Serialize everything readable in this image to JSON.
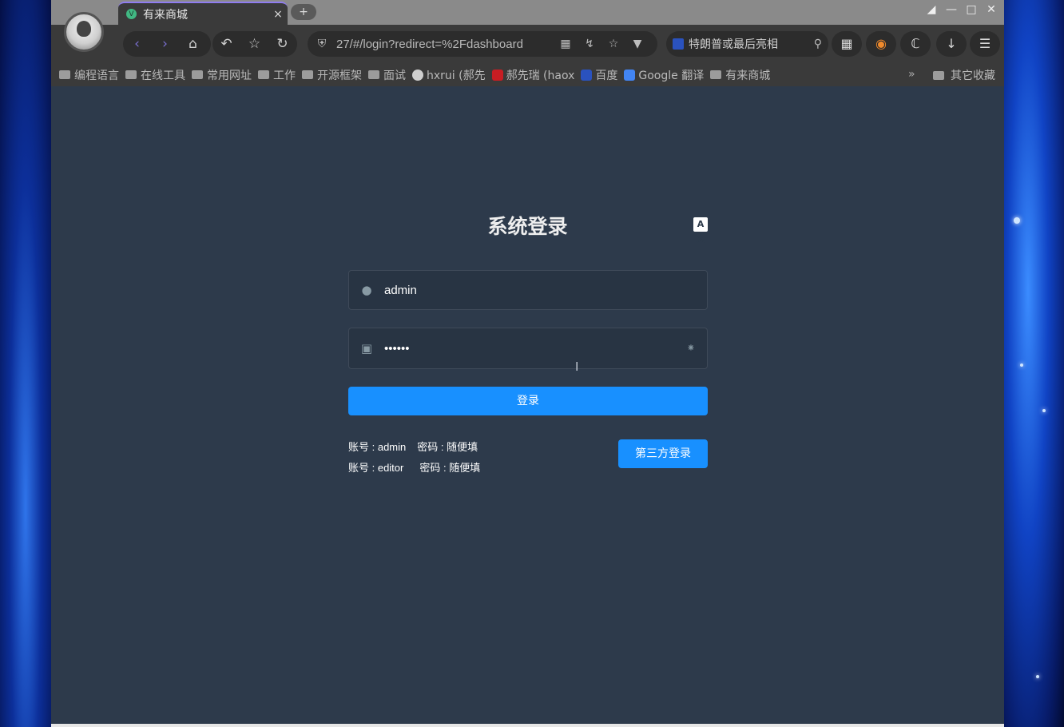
{
  "browser": {
    "tab_title": "有来商城",
    "tab_close": "×",
    "new_tab": "+",
    "url": "27/#/login?redirect=%2Fdashboard",
    "search_text": "特朗普或最后亮相",
    "window_controls": [
      "shirt-icon",
      "minimize-icon",
      "maximize-icon",
      "close-icon"
    ]
  },
  "bookmarks": {
    "items": [
      {
        "label": "编程语言",
        "type": "folder"
      },
      {
        "label": "在线工具",
        "type": "folder"
      },
      {
        "label": "常用网址",
        "type": "folder"
      },
      {
        "label": "工作",
        "type": "folder"
      },
      {
        "label": "开源框架",
        "type": "folder"
      },
      {
        "label": "面试",
        "type": "folder"
      },
      {
        "label": "hxrui (郝先",
        "type": "github"
      },
      {
        "label": "郝先瑞 (haox",
        "type": "gitee"
      },
      {
        "label": "百度",
        "type": "baidu"
      },
      {
        "label": "Google 翻译",
        "type": "google"
      },
      {
        "label": "有来商城",
        "type": "folder"
      }
    ],
    "more": "»",
    "other": "其它收藏"
  },
  "login": {
    "title": "系统登录",
    "lang_icon": "A文",
    "username_value": "admin",
    "password_value": "••••••",
    "submit_label": "登录",
    "tips": [
      {
        "account": "账号 : admin",
        "password": "密码 : 随便填"
      },
      {
        "account": "账号 : editor",
        "password": "密码 : 随便填"
      }
    ],
    "third_party_label": "第三方登录"
  },
  "colors": {
    "page_bg": "#2d3a4b",
    "primary": "#1890ff",
    "input_bg": "#283443"
  }
}
